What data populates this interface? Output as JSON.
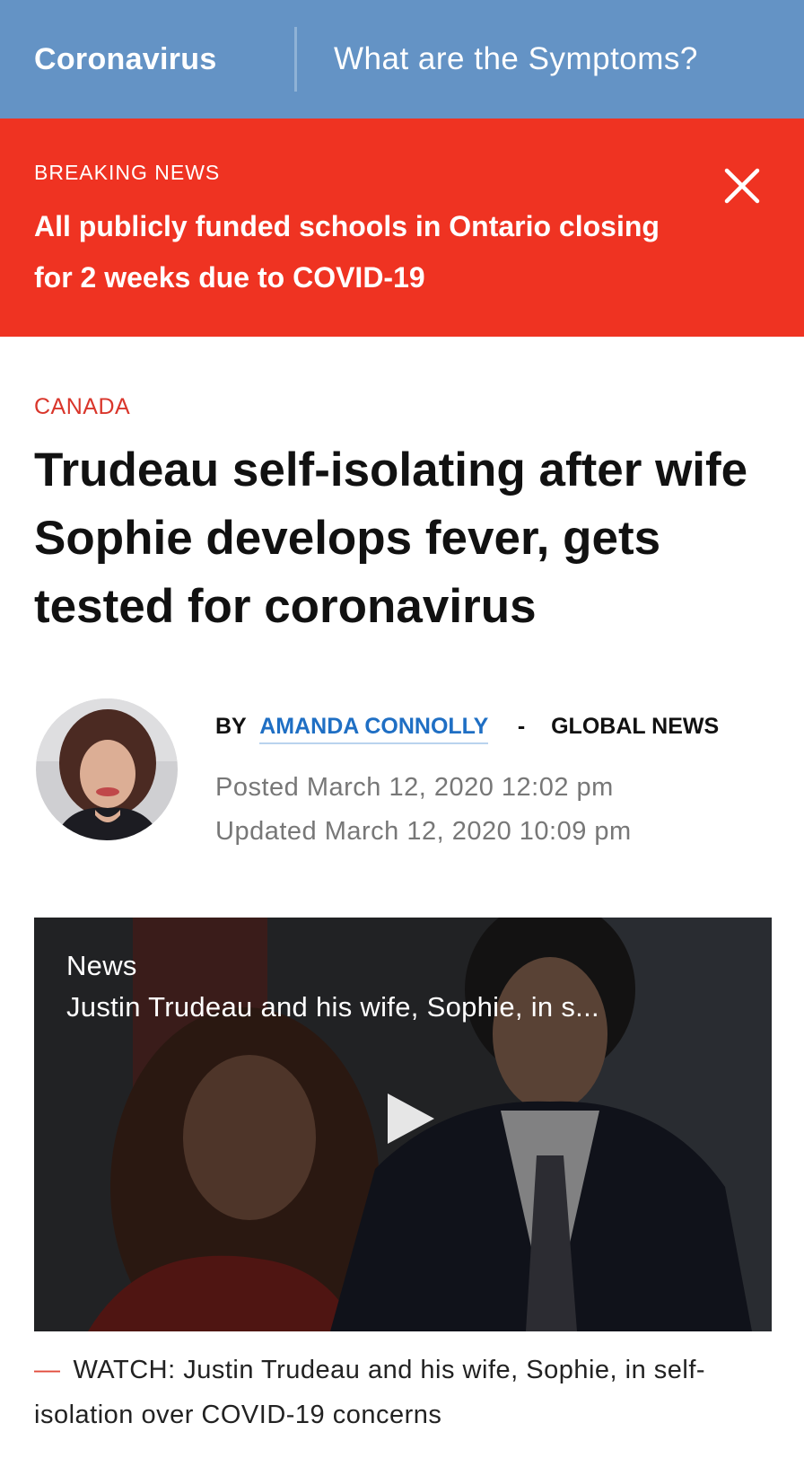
{
  "topnav": {
    "home_label": "Coronavirus",
    "symptoms_label": "What are the Symptoms?"
  },
  "breaking": {
    "kicker": "BREAKING NEWS",
    "headline": "All publicly funded schools in Ontario closing for 2 weeks due to COVID-19",
    "close_icon": "close-icon",
    "background": "#ef3322"
  },
  "article": {
    "category": "CANADA",
    "headline": "Trudeau self-isolating after wife Sophie develops fever, gets tested for coronavirus",
    "byline": {
      "prefix": "BY",
      "author": "AMANDA CONNOLLY",
      "separator": "-",
      "outlet": "GLOBAL NEWS"
    },
    "posted": "Posted March 12, 2020 12:02 pm",
    "updated": "Updated March 12, 2020 10:09 pm",
    "video": {
      "source": "News",
      "title": "Justin Trudeau and his wife, Sophie, in s...",
      "play_icon": "play-icon"
    },
    "caption": {
      "mark": "—",
      "text": "WATCH: Justin Trudeau and his wife, Sophie, in self-isolation over COVID-19 concerns"
    }
  },
  "colors": {
    "nav": "#6493c5",
    "breaking": "#ef3322",
    "category": "#d9362b",
    "author_link": "#1f6fc4"
  }
}
